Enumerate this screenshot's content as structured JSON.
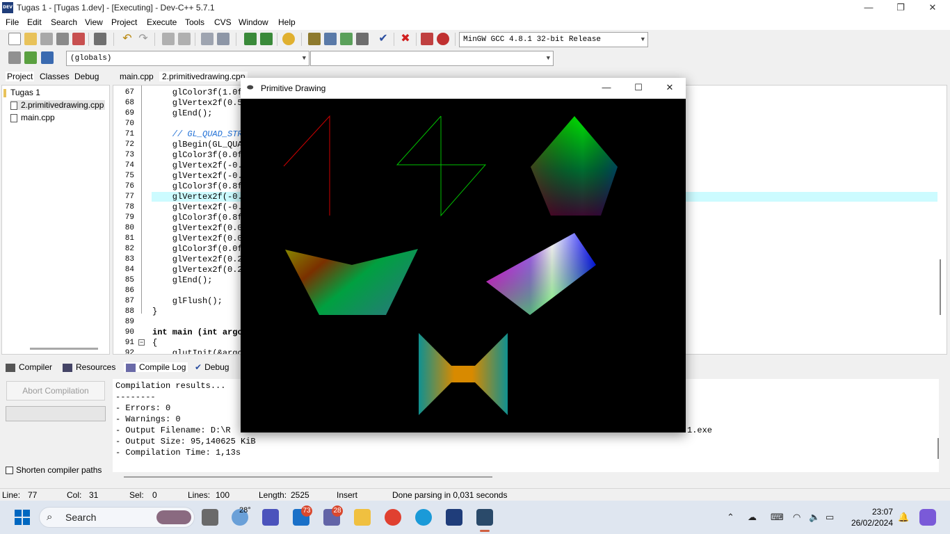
{
  "window": {
    "title": "Tugas 1 - [Tugas 1.dev] - [Executing] - Dev-C++ 5.7.1",
    "app_icon_text": "DEV",
    "min": "—",
    "max": "❐",
    "close": "✕"
  },
  "menu": [
    "File",
    "Edit",
    "Search",
    "View",
    "Project",
    "Execute",
    "Tools",
    "CVS",
    "Window",
    "Help"
  ],
  "toolbar": {
    "compiler": "MinGW GCC 4.8.1 32-bit Release",
    "scope": "(globals)",
    "symbol": ""
  },
  "left_tabs": [
    "Project",
    "Classes",
    "Debug"
  ],
  "project_tree": {
    "root": "Tugas 1",
    "files": [
      "2.primitivedrawing.cpp",
      "main.cpp"
    ]
  },
  "editor_tabs": [
    "main.cpp",
    "2.primitivedrawing.cpp"
  ],
  "code_lines": [
    {
      "n": "67",
      "t": "    glColor3f(1.0f"
    },
    {
      "n": "68",
      "t": "    glVertex2f(0.5"
    },
    {
      "n": "69",
      "t": "    glEnd();"
    },
    {
      "n": "70",
      "t": ""
    },
    {
      "n": "71",
      "t": "    // GL_QUAD_STR"
    },
    {
      "n": "72",
      "t": "    glBegin(GL_QUAD"
    },
    {
      "n": "73",
      "t": "    glColor3f(0.0f"
    },
    {
      "n": "74",
      "t": "    glVertex2f(-0."
    },
    {
      "n": "75",
      "t": "    glVertex2f(-0."
    },
    {
      "n": "76",
      "t": "    glColor3f(0.8f"
    },
    {
      "n": "77",
      "t": "    glVertex2f(-0.("
    },
    {
      "n": "78",
      "t": "    glVertex2f(-0.("
    },
    {
      "n": "79",
      "t": "    glColor3f(0.8f"
    },
    {
      "n": "80",
      "t": "    glVertex2f(0.0!"
    },
    {
      "n": "81",
      "t": "    glVertex2f(0.0!"
    },
    {
      "n": "82",
      "t": "    glColor3f(0.0f"
    },
    {
      "n": "83",
      "t": "    glVertex2f(0.2!"
    },
    {
      "n": "84",
      "t": "    glVertex2f(0.2!"
    },
    {
      "n": "85",
      "t": "    glEnd();"
    },
    {
      "n": "86",
      "t": ""
    },
    {
      "n": "87",
      "t": "    glFlush();"
    },
    {
      "n": "88",
      "t": "}"
    },
    {
      "n": "89",
      "t": ""
    },
    {
      "n": "90",
      "t": "int main (int argc"
    },
    {
      "n": "91",
      "t": "{"
    },
    {
      "n": "92",
      "t": "    glutInit(&argc"
    }
  ],
  "bottom_tabs": [
    "Compiler",
    "Resources",
    "Compile Log",
    "Debug"
  ],
  "abort_button": "Abort Compilation",
  "shorten_paths": "Shorten compiler paths",
  "compile_log": [
    "Compilation results...",
    "--------",
    "- Errors: 0",
    "- Warnings: 0",
    "- Output Filename: D:\\R",
    "- Output Size: 95,140625 KiB",
    "- Compilation Time: 1,13s"
  ],
  "compile_log_tail": "1.exe",
  "status": {
    "line_label": "Line:",
    "line": "77",
    "col_label": "Col:",
    "col": "31",
    "sel_label": "Sel:",
    "sel": "0",
    "lines_label": "Lines:",
    "lines": "100",
    "length_label": "Length:",
    "length": "2525",
    "mode": "Insert",
    "message": "Done parsing in 0,031 seconds"
  },
  "gl_window": {
    "title": "Primitive Drawing",
    "min": "—",
    "max": "☐",
    "close": "✕"
  },
  "taskbar": {
    "search": "Search",
    "weather": "28°",
    "mail_badge": "73",
    "teams_badge": "28",
    "time": "23:07",
    "date": "26/02/2024"
  }
}
